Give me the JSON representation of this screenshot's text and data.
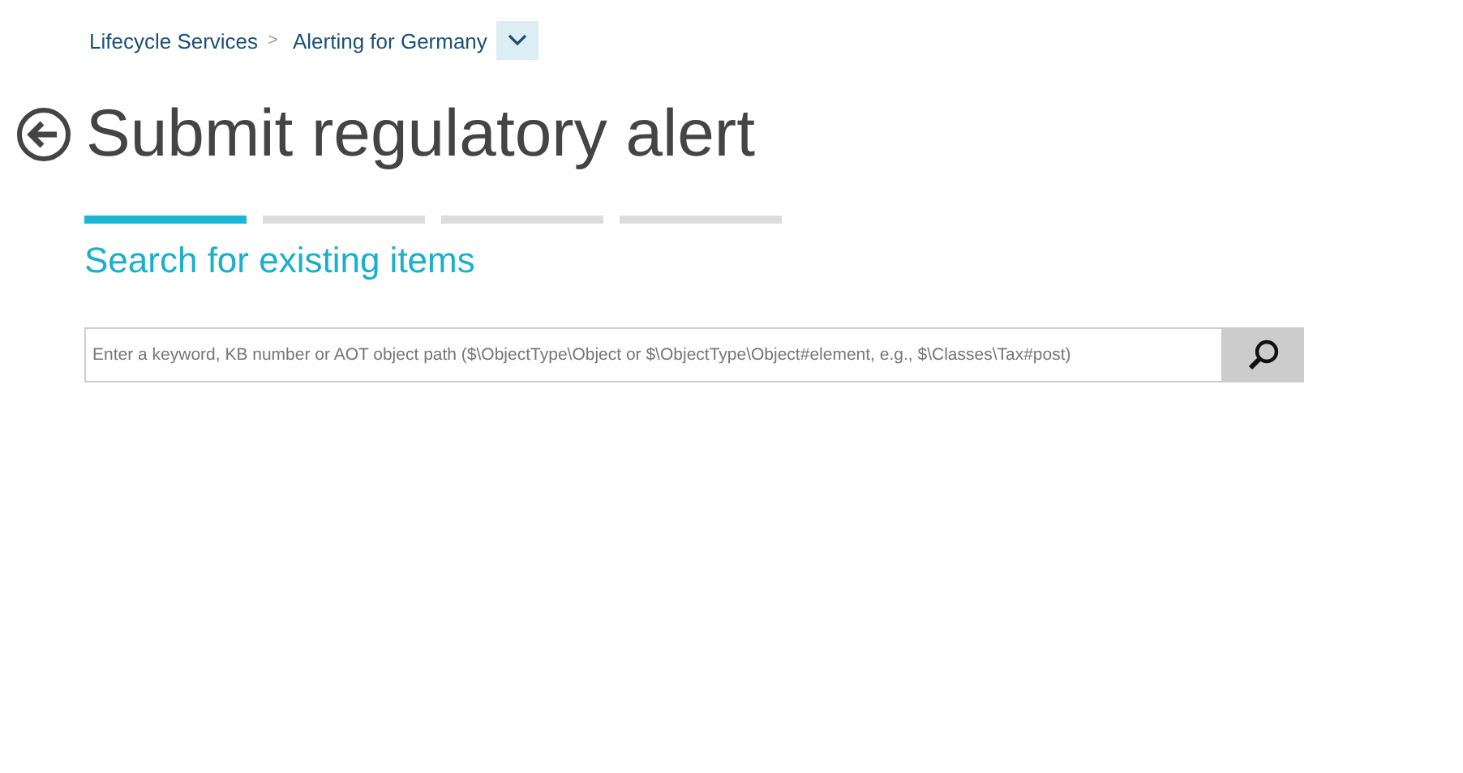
{
  "breadcrumb": {
    "items": [
      "Lifecycle Services",
      "Alerting for Germany"
    ],
    "separator": ">"
  },
  "title": "Submit regulatory alert",
  "steps": [
    {
      "selected": true
    },
    {
      "selected": false
    },
    {
      "selected": false
    },
    {
      "selected": false
    }
  ],
  "step_title": "Search for existing items",
  "search": {
    "placeholder": "Enter a keyword, KB number or AOT object path ($\\ObjectType\\Object or $\\ObjectType\\Object#element, e.g., $\\Classes\\Tax#post)"
  }
}
